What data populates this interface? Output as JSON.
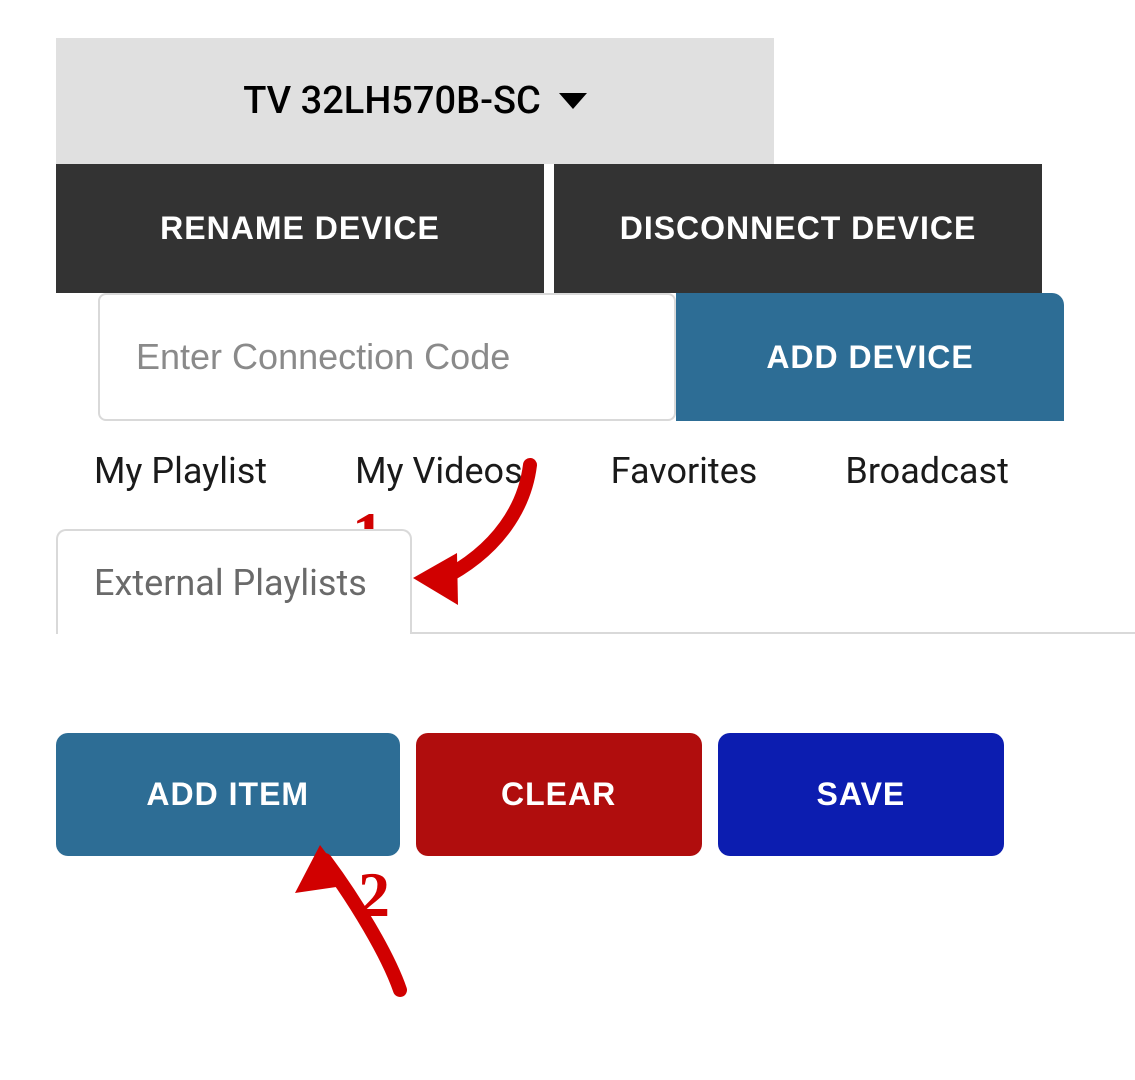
{
  "device_selector": {
    "selected": "TV 32LH570B-SC"
  },
  "device_buttons": {
    "rename": "RENAME DEVICE",
    "disconnect": "DISCONNECT DEVICE"
  },
  "connection": {
    "placeholder": "Enter Connection Code",
    "add_device": "ADD DEVICE"
  },
  "tabs": {
    "my_playlist": "My Playlist",
    "my_videos": "My Videos",
    "favorites": "Favorites",
    "broadcast": "Broadcast",
    "external_playlists": "External Playlists"
  },
  "action_buttons": {
    "add_item": "ADD ITEM",
    "clear": "CLEAR",
    "save": "SAVE"
  },
  "colors": {
    "dark_button": "#333333",
    "teal": "#2d6d95",
    "red": "#b00d0d",
    "blue": "#0c1db0",
    "annotation_red": "#d10000"
  },
  "annotations": {
    "step1": "1",
    "step2": "2"
  }
}
